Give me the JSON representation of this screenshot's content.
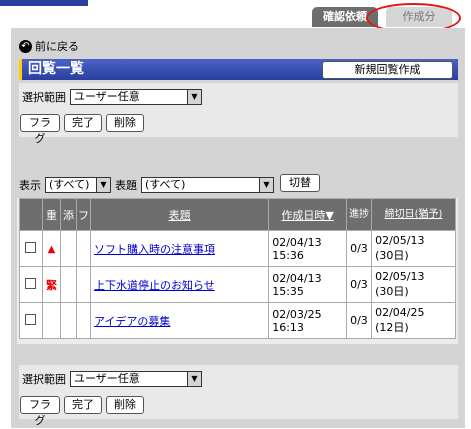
{
  "tabs": {
    "active": "確認依頼",
    "inactive": "作成分"
  },
  "nav": {
    "back_label": "前に戻る"
  },
  "header": {
    "title": "回覧一覧",
    "new_button": "新規回覧作成"
  },
  "filter": {
    "scope_label": "選択範囲",
    "scope_value": "ユーザー任意",
    "flag_btn": "フラグ",
    "done_btn": "完了",
    "delete_btn": "削除"
  },
  "list_filter": {
    "display_label": "表示",
    "display_value": "(すべて)",
    "subject_label": "表題",
    "subject_value": "(すべて)",
    "switch_btn": "切替"
  },
  "columns": {
    "important": "重",
    "attach": "添",
    "flag": "フ",
    "subject": "表題",
    "created": "作成日時▼",
    "progress": "進捗",
    "deadline": "締切日(猶予)"
  },
  "rows": [
    {
      "mark": "▲",
      "subject": "ソフト購入時の注意事項",
      "created_date": "02/04/13",
      "created_time": "15:36",
      "progress": "0/3",
      "deadline_date": "02/05/13",
      "deadline_days": "(30日)"
    },
    {
      "mark": "緊",
      "subject": "上下水道停止のお知らせ",
      "created_date": "02/04/13",
      "created_time": "15:35",
      "progress": "0/3",
      "deadline_date": "02/05/13",
      "deadline_days": "(30日)"
    },
    {
      "mark": "",
      "subject": "アイデアの募集",
      "created_date": "02/03/25",
      "created_time": "16:13",
      "progress": "0/3",
      "deadline_date": "02/04/25",
      "deadline_days": "(12日)"
    }
  ],
  "bottom": {
    "scope_label": "選択範囲",
    "scope_value": "ユーザー任意",
    "flag_btn": "フラグ",
    "done_btn": "完了",
    "delete_btn": "削除"
  }
}
